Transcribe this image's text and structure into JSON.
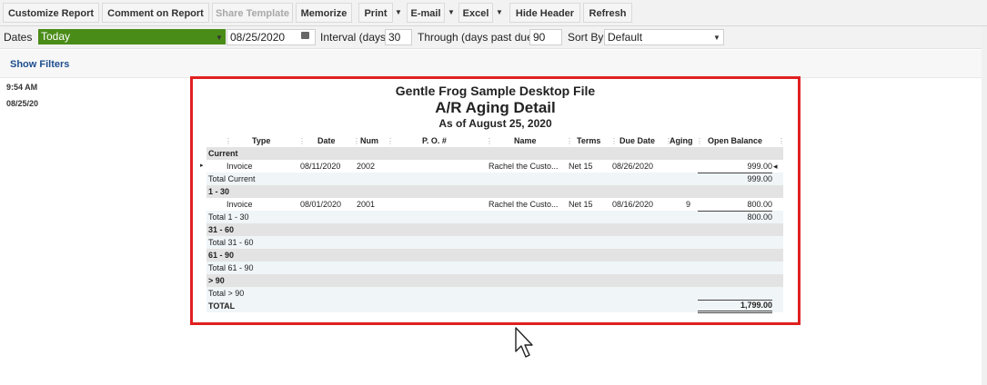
{
  "toolbar": {
    "customize": "Customize Report",
    "comment": "Comment on Report",
    "share": "Share Template",
    "memorize": "Memorize",
    "print": "Print",
    "email": "E-mail",
    "excel": "Excel",
    "hide_header": "Hide Header",
    "refresh": "Refresh"
  },
  "filters": {
    "dates_label": "Dates",
    "dates_value": "Today",
    "date": "08/25/2020",
    "interval_label": "Interval (days)",
    "interval_value": "30",
    "through_label": "Through (days past due)",
    "through_value": "90",
    "sort_label": "Sort By",
    "sort_value": "Default"
  },
  "show_filters": "Show Filters",
  "meta": {
    "time": "9:54 AM",
    "date": "08/25/20"
  },
  "report": {
    "company": "Gentle Frog Sample Desktop File",
    "title": "A/R Aging Detail",
    "subtitle": "As of August 25, 2020",
    "columns": [
      "Type",
      "Date",
      "Num",
      "P. O. #",
      "Name",
      "Terms",
      "Due Date",
      "Aging",
      "Open Balance"
    ],
    "rows": {
      "current_label": "Current",
      "inv1": {
        "type": "Invoice",
        "date": "08/11/2020",
        "num": "2002",
        "name": "Rachel the Custo...",
        "terms": "Net 15",
        "due": "08/26/2020",
        "aging": "",
        "balance": "999.00"
      },
      "total_current_label": "Total Current",
      "total_current_value": "999.00",
      "b1_30_label": "1 - 30",
      "inv2": {
        "type": "Invoice",
        "date": "08/01/2020",
        "num": "2001",
        "name": "Rachel the Custo...",
        "terms": "Net 15",
        "due": "08/16/2020",
        "aging": "9",
        "balance": "800.00"
      },
      "total_1_30_label": "Total 1 - 30",
      "total_1_30_value": "800.00",
      "b31_60_label": "31 - 60",
      "total_31_60_label": "Total 31 - 60",
      "b61_90_label": "61 - 90",
      "total_61_90_label": "Total 61 - 90",
      "b90_label": "> 90",
      "total_90_label": "Total > 90",
      "total_label": "TOTAL",
      "total_value": "1,799.00"
    }
  }
}
